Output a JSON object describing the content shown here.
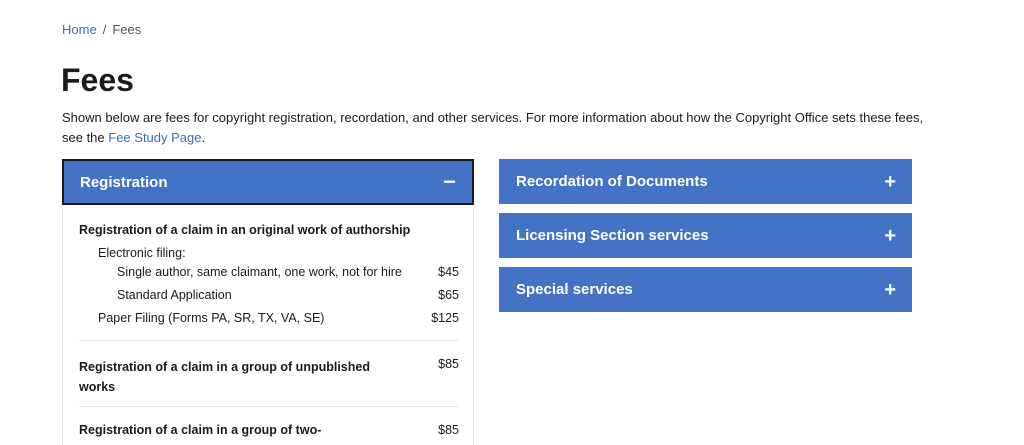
{
  "breadcrumb": {
    "home": "Home",
    "sep": "/",
    "current": "Fees"
  },
  "page_title": "Fees",
  "intro": {
    "text_before": "Shown below are fees for copyright registration, recordation, and other services. For more information about how the Copyright Office sets these fees, see the ",
    "link": "Fee Study Page",
    "text_after": "."
  },
  "registration": {
    "title": "Registration",
    "toggle": "−",
    "original_work": {
      "heading": "Registration of a claim in an original work of authorship",
      "electronic_label": "Electronic filing:",
      "single_label": "Single author, same claimant, one work, not for hire",
      "single_fee": "$45",
      "standard_label": "Standard Application",
      "standard_fee": "$65",
      "paper_label": "Paper Filing (Forms PA, SR, TX, VA, SE)",
      "paper_fee": "$125"
    },
    "group_unpublished": {
      "line1": "Registration of a claim in a group of unpublished",
      "line2": "works",
      "fee": "$85"
    },
    "group_two": {
      "line1": "Registration of a claim in a group of two-",
      "fee": "$85"
    }
  },
  "right_sections": [
    {
      "title": "Recordation of Documents",
      "toggle": "+"
    },
    {
      "title": "Licensing Section services",
      "toggle": "+"
    },
    {
      "title": "Special services",
      "toggle": "+"
    }
  ],
  "colors": {
    "accent": "#4472c4",
    "link": "#3a6fb4"
  }
}
